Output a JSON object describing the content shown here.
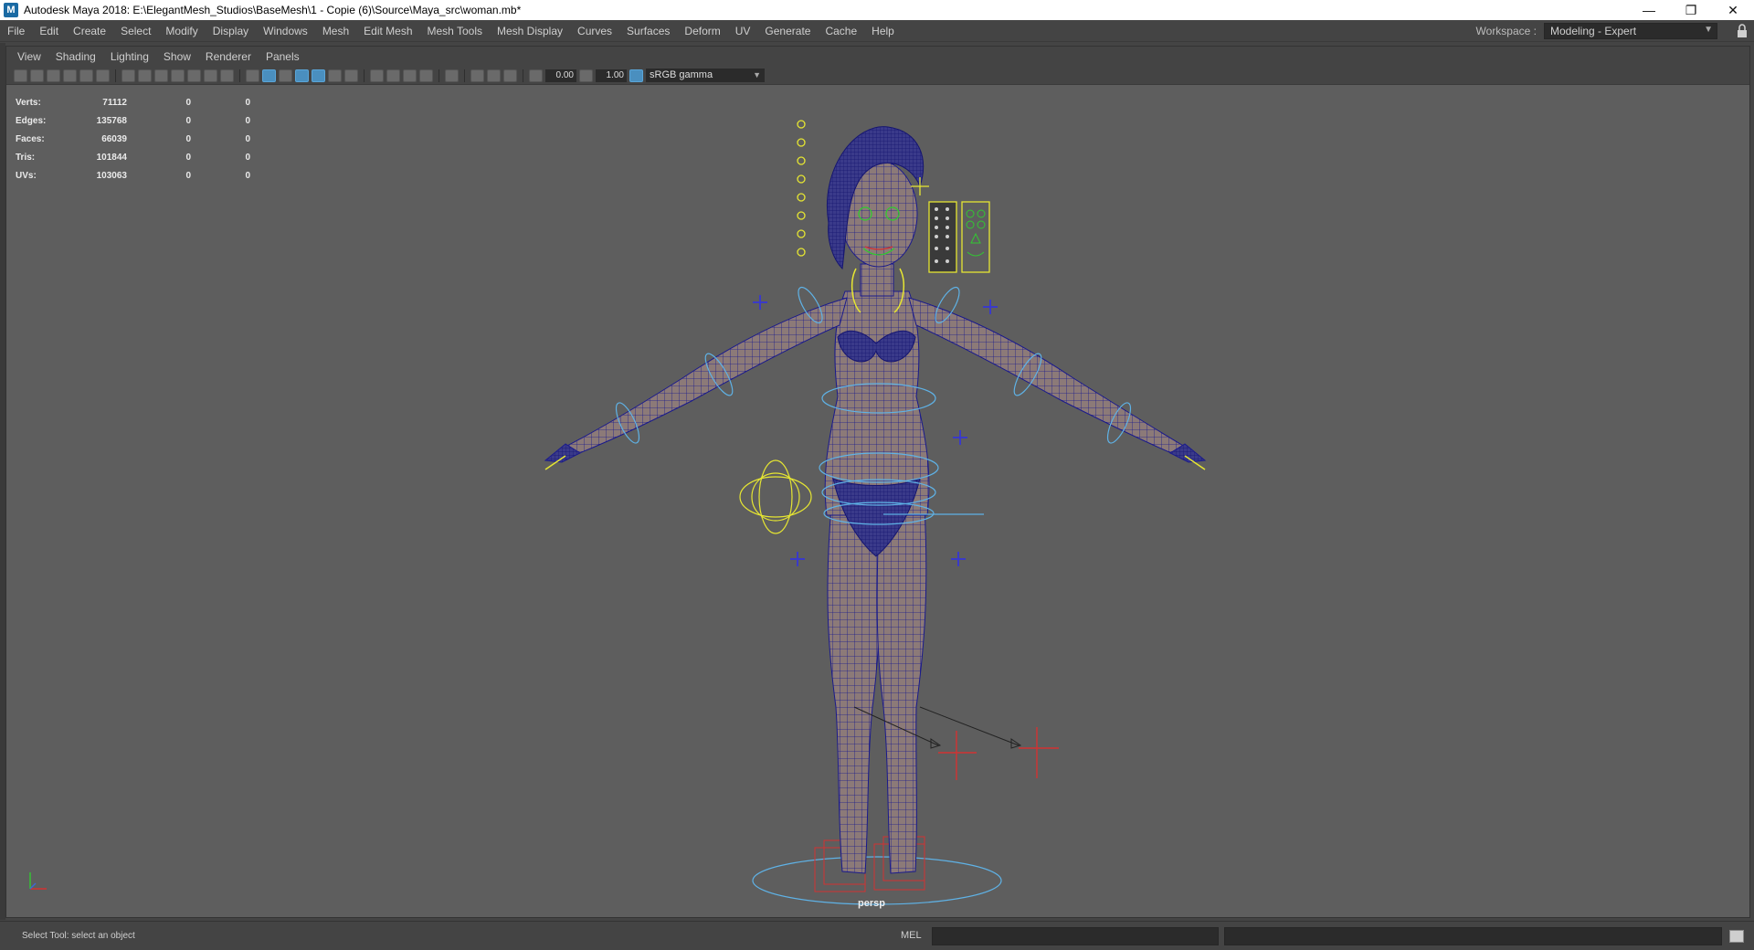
{
  "window": {
    "title": "Autodesk Maya 2018: E:\\ElegantMesh_Studios\\BaseMesh\\1 - Copie (6)\\Source\\Maya_src\\woman.mb*",
    "app_icon_letter": "M",
    "minimize": "—",
    "restore": "❐",
    "close": "✕"
  },
  "menubar": {
    "items": [
      "File",
      "Edit",
      "Create",
      "Select",
      "Modify",
      "Display",
      "Windows",
      "Mesh",
      "Edit Mesh",
      "Mesh Tools",
      "Mesh Display",
      "Curves",
      "Surfaces",
      "Deform",
      "UV",
      "Generate",
      "Cache",
      "Help"
    ],
    "workspace_label": "Workspace :",
    "workspace_value": "Modeling - Expert"
  },
  "panel_menu": {
    "items": [
      "View",
      "Shading",
      "Lighting",
      "Show",
      "Renderer",
      "Panels"
    ]
  },
  "panel_toolbar": {
    "exposure": "0.00",
    "gamma": "1.00",
    "color_space": "sRGB gamma"
  },
  "hud": {
    "rows": [
      {
        "label": "Verts:",
        "v1": "71112",
        "v2": "0",
        "v3": "0"
      },
      {
        "label": "Edges:",
        "v1": "135768",
        "v2": "0",
        "v3": "0"
      },
      {
        "label": "Faces:",
        "v1": "66039",
        "v2": "0",
        "v3": "0"
      },
      {
        "label": "Tris:",
        "v1": "101844",
        "v2": "0",
        "v3": "0"
      },
      {
        "label": "UVs:",
        "v1": "103063",
        "v2": "0",
        "v3": "0"
      }
    ]
  },
  "viewport": {
    "camera_label": "persp",
    "background_color": "#5e5e5e",
    "mesh_fill_color": "#8c7a78",
    "wire_color": "#1a1a8c",
    "control_blue": "#5fb2e6",
    "control_yellow": "#e6e632",
    "control_red": "#d23232"
  },
  "statusbar": {
    "help_line": "Select Tool: select an object",
    "mel_label": "MEL"
  }
}
